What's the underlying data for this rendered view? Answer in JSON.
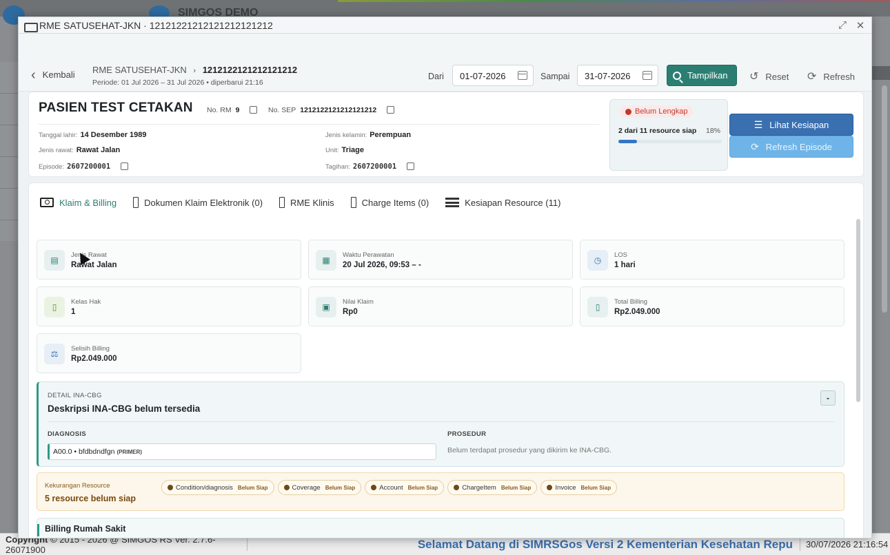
{
  "background": {
    "brand": "SIMGOS DEMO"
  },
  "statusbar": {
    "copyright_label": "Copyright",
    "copyright_text": "2015 - 2026 @ SIMGOS RS Ver. 2.7.6-26071900",
    "marquee": "Selamat Datang di SIMRSGos Versi 2 Kementerian Kesehatan Repu",
    "datetime": "30/07/2026 21:16:54"
  },
  "window": {
    "title": "RME SATUSEHAT-JKN · 12121221212121212121212"
  },
  "header": {
    "back_label": "Kembali",
    "breadcrumb_root": "RME SATUSEHAT-JKN",
    "breadcrumb_current": "1212122121212121212",
    "periode": "Periode: 01 Jul 2026 – 31 Jul 2026 • diperbarui 21:16",
    "dari_label": "Dari",
    "dari_value": "01-07-2026",
    "sampai_label": "Sampai",
    "sampai_value": "31-07-2026",
    "tampilkan_label": "Tampilkan",
    "reset_label": "Reset",
    "refresh_label": "Refresh"
  },
  "patient": {
    "name": "PASIEN TEST CETAKAN",
    "rm_label": "No. RM",
    "rm_value": "9",
    "sep_label": "No. SEP",
    "sep_value": "1212122121212121212",
    "tgl_lahir_label": "Tanggal lahir:",
    "tgl_lahir_value": "14 Desember 1989",
    "jenis_kelamin_label": "Jenis kelamin:",
    "jenis_kelamin_value": "Perempuan",
    "jenis_rawat_label": "Jenis rawat:",
    "jenis_rawat_value": "Rawat Jalan",
    "unit_label": "Unit:",
    "unit_value": "Triage",
    "episode_label": "Episode:",
    "episode_value": "2607200001",
    "tagihan_label": "Tagihan:",
    "tagihan_value": "2607200001"
  },
  "readiness": {
    "status": "Belum Lengkap",
    "summary": "2 dari 11 resource siap",
    "percent_label": "18%",
    "percent": 0.18,
    "lihat_label": "Lihat Kesiapan",
    "refresh_episode_label": "Refresh Episode",
    "status_color": "#c0392b"
  },
  "tabs": [
    {
      "label": "Klaim & Billing",
      "icon": "billing-icon"
    },
    {
      "label": "Dokumen Klaim Elektronik (0)",
      "icon": "document-icon"
    },
    {
      "label": "RME Klinis",
      "icon": "document-icon"
    },
    {
      "label": "Charge Items (0)",
      "icon": "document-icon"
    },
    {
      "label": "Kesiapan Resource (11)",
      "icon": "list-icon"
    }
  ],
  "stats": [
    {
      "label": "Jenis Rawat",
      "value": "Rawat Jalan",
      "icon": "clipboard-icon"
    },
    {
      "label": "Waktu Perawatan",
      "value": "20 Jul 2026, 09:53 – -",
      "icon": "calendar-icon"
    },
    {
      "label": "LOS",
      "value": "1 hari",
      "icon": "clock-icon"
    },
    {
      "label": "Kelas Hak",
      "value": "1",
      "icon": "bed-icon"
    },
    {
      "label": "Nilai Klaim",
      "value": "Rp0",
      "icon": "money-icon"
    },
    {
      "label": "Total Billing",
      "value": "Rp2.049.000",
      "icon": "receipt-icon"
    },
    {
      "label": "Selisih Billing",
      "value": "Rp2.049.000",
      "icon": "scale-icon"
    }
  ],
  "inacbg": {
    "header": "DETAIL INA-CBG",
    "title": "Deskripsi INA-CBG belum tersedia",
    "collapse_label": "-",
    "diagnosis_label": "DIAGNOSIS",
    "diagnosis_value": "A00.0 • bfdbdndfgn",
    "diagnosis_tag": "(PRIMER)",
    "prosedur_label": "PROSEDUR",
    "prosedur_empty": "Belum terdapat prosedur yang dikirim ke INA-CBG."
  },
  "kekurangan": {
    "header": "Kekurangan Resource",
    "value": "5 resource belum siap",
    "chips": [
      {
        "name": "Condition/diagnosis",
        "status": "Belum Siap"
      },
      {
        "name": "Coverage",
        "status": "Belum Siap"
      },
      {
        "name": "Account",
        "status": "Belum Siap"
      },
      {
        "name": "ChargeItem",
        "status": "Belum Siap"
      },
      {
        "name": "Invoice",
        "status": "Belum Siap"
      }
    ]
  },
  "billing": {
    "title": "Billing Rumah Sakit"
  }
}
